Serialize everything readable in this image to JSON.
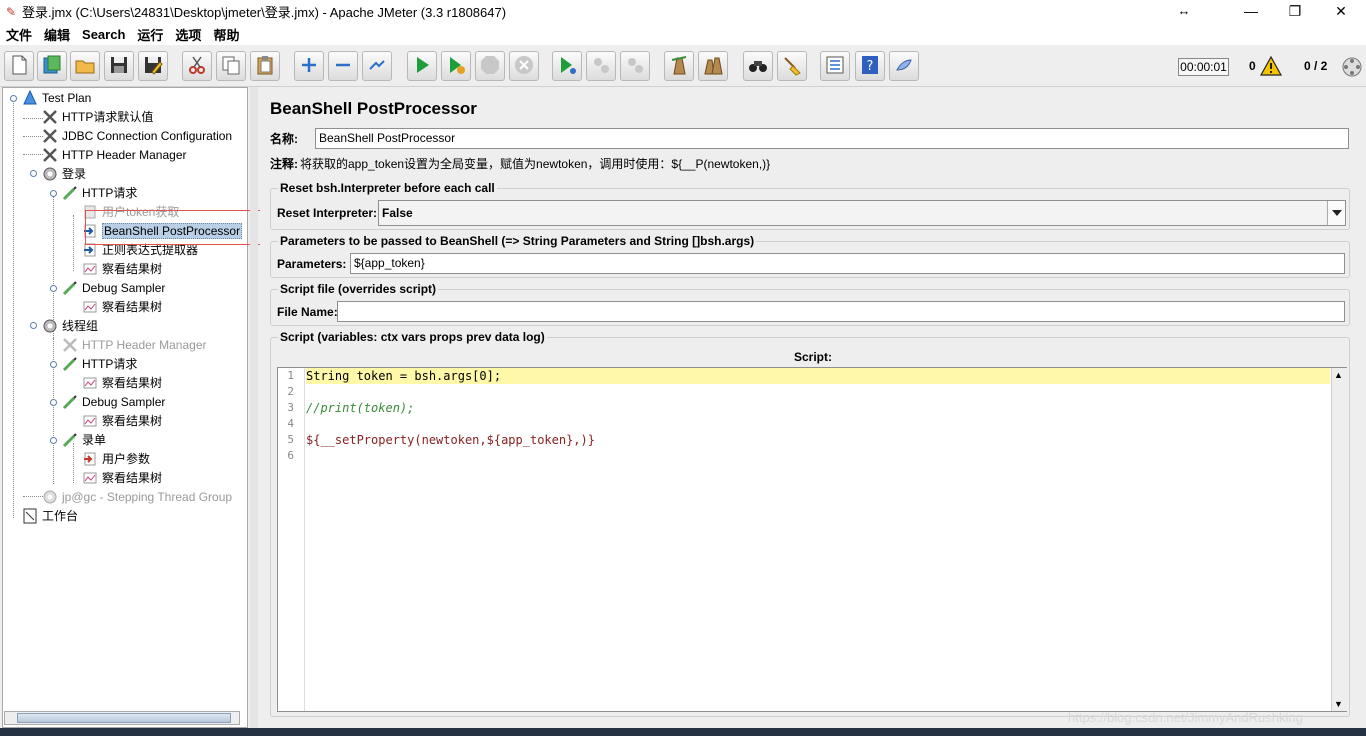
{
  "window": {
    "title": "登录.jmx (C:\\Users\\24831\\Desktop\\jmeter\\登录.jmx) - Apache JMeter (3.3 r1808647)",
    "app_icon": "feather-icon",
    "resize_glyph": "↔",
    "minimize_glyph": "—",
    "restore_glyph": "❐",
    "close_glyph": "✕"
  },
  "menu": [
    "文件",
    "编辑",
    "Search",
    "运行",
    "选项",
    "帮助"
  ],
  "toolbar": {
    "buttons": [
      "new-icon",
      "templates-icon",
      "open-icon",
      "save-icon",
      "save-as-icon",
      "cut-icon",
      "copy-icon",
      "paste-icon",
      "expand-icon",
      "collapse-icon",
      "toggle-icon",
      "start-icon",
      "start-no-pause-icon",
      "stop-icon",
      "shutdown-icon",
      "remote-start-icon",
      "remote-stop-icon",
      "remote-shutdown-icon",
      "clear-icon",
      "clear-all-icon",
      "search-icon",
      "reset-search-icon",
      "function-helper-icon",
      "help-icon",
      "logger-icon"
    ],
    "timer": "00:00:01",
    "error_count": "0",
    "threads": "0 / 2",
    "warn_color": "#f5c400"
  },
  "tree": [
    {
      "label": "Test Plan",
      "icon": "testplan-icon",
      "disabled": false,
      "selected": false
    },
    {
      "label": "HTTP请求默认值",
      "icon": "config-icon",
      "disabled": false,
      "selected": false
    },
    {
      "label": "JDBC Connection Configuration",
      "icon": "config-icon",
      "disabled": false,
      "selected": false
    },
    {
      "label": "HTTP Header Manager",
      "icon": "config-icon",
      "disabled": false,
      "selected": false
    },
    {
      "label": "登录",
      "icon": "threadgroup-icon",
      "disabled": false,
      "selected": false
    },
    {
      "label": "HTTP请求",
      "icon": "sampler-icon",
      "disabled": false,
      "selected": false
    },
    {
      "label": "用户token获取",
      "icon": "preprocessor-icon",
      "disabled": true,
      "selected": false
    },
    {
      "label": "BeanShell PostProcessor",
      "icon": "postprocessor-icon",
      "disabled": false,
      "selected": true
    },
    {
      "label": "正则表达式提取器",
      "icon": "postprocessor-icon",
      "disabled": false,
      "selected": false
    },
    {
      "label": "察看结果树",
      "icon": "listener-icon",
      "disabled": false,
      "selected": false
    },
    {
      "label": "Debug Sampler",
      "icon": "sampler-icon",
      "disabled": false,
      "selected": false
    },
    {
      "label": "察看结果树",
      "icon": "listener-icon",
      "disabled": false,
      "selected": false
    },
    {
      "label": "线程组",
      "icon": "threadgroup-icon",
      "disabled": false,
      "selected": false
    },
    {
      "label": "HTTP Header Manager",
      "icon": "config-icon",
      "disabled": true,
      "selected": false
    },
    {
      "label": "HTTP请求",
      "icon": "sampler-icon",
      "disabled": false,
      "selected": false
    },
    {
      "label": "察看结果树",
      "icon": "listener-icon",
      "disabled": false,
      "selected": false
    },
    {
      "label": "Debug Sampler",
      "icon": "sampler-icon",
      "disabled": false,
      "selected": false
    },
    {
      "label": "察看结果树",
      "icon": "listener-icon",
      "disabled": false,
      "selected": false
    },
    {
      "label": "录单",
      "icon": "sampler-icon",
      "disabled": false,
      "selected": false
    },
    {
      "label": "用户参数",
      "icon": "preprocessor-icon",
      "disabled": false,
      "selected": false
    },
    {
      "label": "察看结果树",
      "icon": "listener-icon",
      "disabled": false,
      "selected": false
    },
    {
      "label": "jp@gc - Stepping Thread Group",
      "icon": "threadgroup-icon",
      "disabled": true,
      "selected": false
    },
    {
      "label": "工作台",
      "icon": "workbench-icon",
      "disabled": false,
      "selected": false
    }
  ],
  "editor": {
    "title": "BeanShell PostProcessor",
    "name_label": "名称:",
    "name_value": "BeanShell PostProcessor",
    "comment_label": "注释:",
    "comment_value": "将获取的app_token设置为全局变量，赋值为newtoken，调用时使用：${__P(newtoken,)}",
    "reset_group": "Reset bsh.Interpreter before each call",
    "reset_label": "Reset Interpreter:",
    "reset_value": "False",
    "params_group": "Parameters to be passed to BeanShell (=> String Parameters and String []bsh.args)",
    "params_label": "Parameters:",
    "params_value": "${app_token}",
    "file_group": "Script file (overrides script)",
    "file_label": "File Name:",
    "file_value": "",
    "script_group": "Script (variables: ctx vars props prev data log)",
    "script_header": "Script:",
    "line_numbers": [
      "1",
      "2",
      "3",
      "4",
      "5",
      "6"
    ],
    "code_lines": [
      "String token = bsh.args[0];",
      "",
      "//print(token);",
      "",
      "${__setProperty(newtoken,${app_token},)}",
      ""
    ]
  },
  "watermark": "https://blog.csdn.net/JimmyAndRushking"
}
